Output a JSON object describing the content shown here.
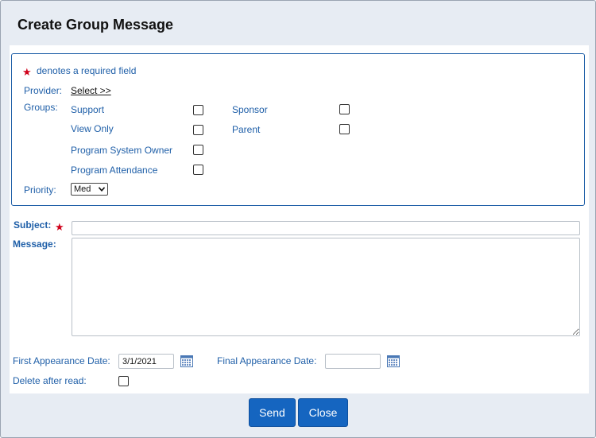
{
  "dialog": {
    "title": "Create Group Message"
  },
  "form": {
    "required_note": "denotes a required field",
    "required_star": "★",
    "provider_label": "Provider:",
    "provider_select_link": "Select  >>",
    "groups_label": "Groups:",
    "groups": [
      {
        "label": "Support",
        "checked": false
      },
      {
        "label": "View Only",
        "checked": false
      },
      {
        "label": "Program System Owner",
        "checked": false
      },
      {
        "label": "Program Attendance",
        "checked": false
      },
      {
        "label": "Sponsor",
        "checked": false
      },
      {
        "label": "Parent",
        "checked": false
      }
    ],
    "priority_label": "Priority:",
    "priority_value": "Med",
    "subject_label": "Subject:",
    "subject_value": "",
    "message_label": "Message:",
    "message_value": "",
    "first_date_label": "First Appearance Date:",
    "first_date_value": "3/1/2021",
    "final_date_label": "Final Appearance Date:",
    "final_date_value": "",
    "delete_label": "Delete after read:",
    "delete_checked": false
  },
  "buttons": {
    "send": "Send",
    "close": "Close"
  },
  "colors": {
    "accent": "#1565c0",
    "label_blue": "#1f5fa8",
    "required_red": "#d0021b",
    "dialog_bg": "#e7ecf3"
  },
  "icons": {
    "calendar": "calendar-icon",
    "dropdown": "chevron-down-icon"
  }
}
